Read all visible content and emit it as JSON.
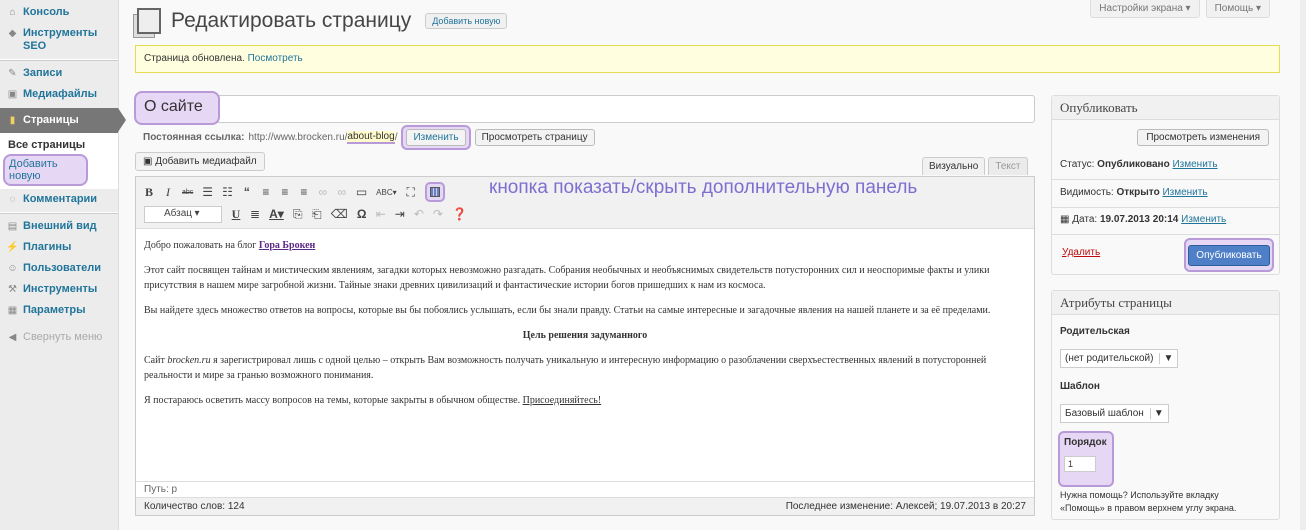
{
  "sidebar": {
    "items": [
      {
        "label": "Консоль",
        "icon": "home-icon"
      },
      {
        "label": "Инструменты SEO",
        "icon": "shield-icon"
      },
      {
        "label": "Записи",
        "icon": "pin-icon"
      },
      {
        "label": "Медиафайлы",
        "icon": "media-icon"
      },
      {
        "label": "Страницы",
        "icon": "pages-icon"
      },
      {
        "label": "Комментарии",
        "icon": "comment-icon"
      },
      {
        "label": "Внешний вид",
        "icon": "appearance-icon"
      },
      {
        "label": "Плагины",
        "icon": "plugin-icon"
      },
      {
        "label": "Пользователи",
        "icon": "users-icon"
      },
      {
        "label": "Инструменты",
        "icon": "tools-icon"
      },
      {
        "label": "Параметры",
        "icon": "settings-icon"
      }
    ],
    "sub_all": "Все страницы",
    "sub_add": "Добавить новую",
    "collapse": "Свернуть меню"
  },
  "top": {
    "screen_options": "Настройки экрана ▾",
    "help": "Помощь ▾"
  },
  "header": {
    "title": "Редактировать страницу",
    "add_new": "Добавить новую"
  },
  "notice": {
    "text": "Страница обновлена.",
    "link": "Посмотреть"
  },
  "post": {
    "title": "О сайте",
    "permalink_label": "Постоянная ссылка:",
    "permalink_base": "http://www.brocken.ru/",
    "permalink_slug": "about-blog",
    "permalink_end": "/",
    "edit_button": "Изменить",
    "view_button": "Просмотреть страницу"
  },
  "editor": {
    "media_button": "Добавить медиафайл",
    "tab_visual": "Визуально",
    "tab_text": "Текст",
    "format_select": "Абзац",
    "annotation": "кнопка показать/скрыть дополнительную панель",
    "p1_text": "Добро пожаловать на блог ",
    "p1_link": "Гора Брокен",
    "p2": "Этот сайт посвящен тайнам и мистическим явлениям, загадки которых невозможно разгадать. Собрания необычных и необъяснимых свидетельств потусторонних сил и неоспоримые факты и улики присутствия в нашем мире загробной жизни. Тайные знаки древних цивилизаций и фантастические истории богов пришедших к нам из космоса.",
    "p3": "Вы найдете здесь множество ответов на вопросы, которые вы бы побоялись услышать, если бы знали правду. Статьи на самые интересные и загадочные явления на нашей планете и за её пределами.",
    "p4": "Цель решения задуманного",
    "p5a": "Сайт ",
    "p5b": "brocken.ru",
    "p5c": " я зарегистрировал лишь с одной целью – открыть Вам возможность получать уникальную и интересную информацию о разоблачении сверхъестественных явлений в потусторонней реальности и мире за гранью возможного понимания.",
    "p6a": "Я постараюсь осветить массу вопросов на темы, которые закрыты в обычном обществе. ",
    "p6b": "Присоединяйтесь!",
    "path": "Путь: p",
    "word_count": "Количество слов: 124",
    "last_edit": "Последнее изменение: Алексей; 19.07.2013 в 20:27"
  },
  "publish": {
    "title": "Опубликовать",
    "preview_button": "Просмотреть изменения",
    "status_label": "Статус:",
    "status_value": "Опубликовано",
    "visibility_label": "Видимость:",
    "visibility_value": "Открыто",
    "date_label": "Дата:",
    "date_value": "19.07.2013 20:14",
    "edit_link": "Изменить",
    "delete": "Удалить",
    "publish_button": "Опубликовать"
  },
  "attributes": {
    "title": "Атрибуты страницы",
    "parent_label": "Родительская",
    "parent_value": "(нет родительской)",
    "template_label": "Шаблон",
    "template_value": "Базовый шаблон",
    "order_label": "Порядок",
    "order_value": "1",
    "help_line1": "Нужна помощь? Используйте вкладку",
    "help_line2": "«Помощь» в правом верхнем углу экрана."
  }
}
